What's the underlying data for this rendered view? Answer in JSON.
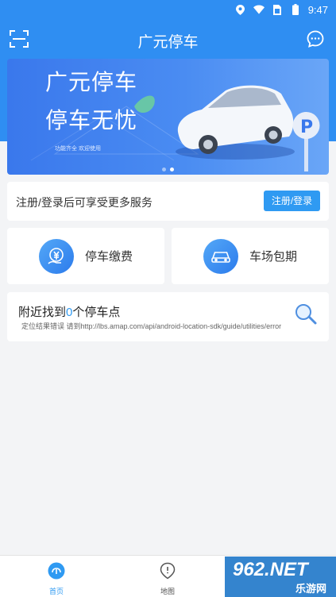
{
  "status_bar": {
    "time": "9:47",
    "icons": [
      "location-icon",
      "wifi-icon",
      "sim-icon",
      "battery-icon"
    ]
  },
  "app_bar": {
    "title": "广元停车",
    "left_icon": "scan-icon",
    "right_icon": "chat-bubble-icon"
  },
  "banner": {
    "title": "广元停车",
    "subtitle": "停车无忧",
    "small_text": "功能齐全 欢迎使用",
    "slide_count": 2,
    "active_slide": 1
  },
  "login_prompt": {
    "text": "注册/登录后可享受更多服务",
    "button_label": "注册/登录"
  },
  "services": [
    {
      "label": "停车缴费",
      "icon": "parking-fee-icon"
    },
    {
      "label": "车场包期",
      "icon": "car-icon"
    }
  ],
  "nearby": {
    "prefix": "附近找到",
    "count": "0",
    "suffix": "个停车点",
    "error": "定位结果错误 请到http://lbs.amap.com/api/android-location-sdk/guide/utilities/error",
    "icon": "magnifier-icon"
  },
  "tab_bar": {
    "tabs": [
      {
        "label": "首页",
        "icon": "home-icon",
        "active": true
      },
      {
        "label": "地图",
        "icon": "map-pin-icon",
        "active": false
      }
    ]
  },
  "watermark": {
    "line1": "962.NET",
    "line2": "乐游网"
  },
  "colors": {
    "primary": "#2f8ef2",
    "accent": "#2f9af2",
    "background": "#f3f4f6"
  }
}
